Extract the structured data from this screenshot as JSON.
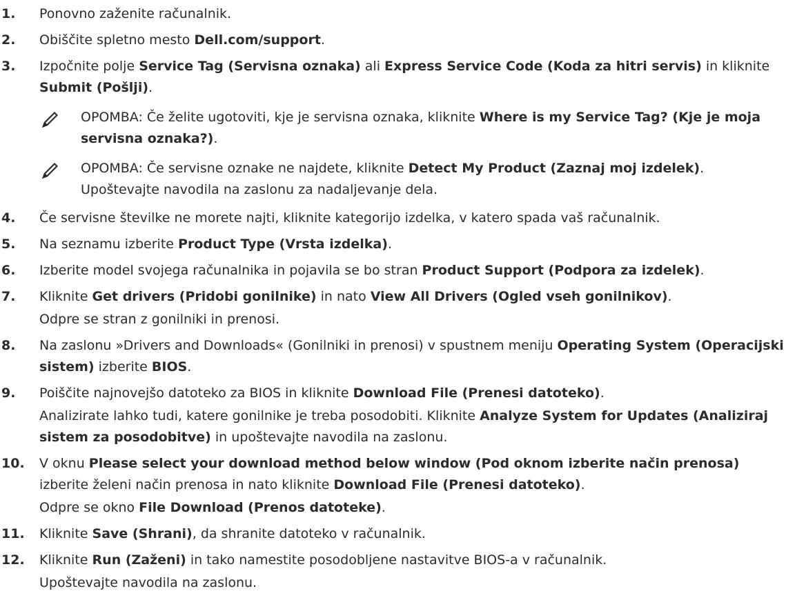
{
  "steps": [
    {
      "num": "1.",
      "parts": [
        {
          "t": "Ponovno zaženite računalnik."
        }
      ]
    },
    {
      "num": "2.",
      "parts": [
        {
          "t": "Obiščite spletno mesto "
        },
        {
          "b": "Dell.com/support"
        },
        {
          "t": "."
        }
      ]
    },
    {
      "num": "3.",
      "parts": [
        {
          "t": "Izpočnite polje "
        },
        {
          "b": "Service Tag (Servisna oznaka)"
        },
        {
          "t": " ali "
        },
        {
          "b": "Express Service Code (Koda za hitri servis)"
        },
        {
          "t": " in kliknite "
        },
        {
          "b": "Submit (Pošlji)"
        },
        {
          "t": "."
        }
      ],
      "notes": [
        {
          "label": "OPOMBA:",
          "parts": [
            {
              "t": " Če želite ugotoviti, kje je servisna oznaka, kliknite "
            },
            {
              "b": "Where is my Service Tag? (Kje je moja servisna oznaka?)"
            },
            {
              "t": "."
            }
          ]
        },
        {
          "label": "OPOMBA:",
          "parts": [
            {
              "t": " Če servisne oznake ne najdete, kliknite "
            },
            {
              "b": "Detect My Product (Zaznaj moj izdelek)"
            },
            {
              "t": ". Upoštevajte navodila na zaslonu za nadaljevanje dela."
            }
          ]
        }
      ]
    },
    {
      "num": "4.",
      "parts": [
        {
          "t": "Če servisne številke ne morete najti, kliknite kategorijo izdelka, v katero spada vaš računalnik."
        }
      ]
    },
    {
      "num": "5.",
      "parts": [
        {
          "t": "Na seznamu izberite "
        },
        {
          "b": "Product Type (Vrsta izdelka)"
        },
        {
          "t": "."
        }
      ]
    },
    {
      "num": "6.",
      "parts": [
        {
          "t": "Izberite model svojega računalnika in pojavila se bo stran "
        },
        {
          "b": "Product Support (Podpora za izdelek)"
        },
        {
          "t": "."
        }
      ]
    },
    {
      "num": "7.",
      "parts": [
        {
          "t": "Kliknite "
        },
        {
          "b": "Get drivers (Pridobi gonilnike)"
        },
        {
          "t": " in nato "
        },
        {
          "b": "View All Drivers (Ogled vseh gonilnikov)"
        },
        {
          "t": "."
        }
      ],
      "subs": [
        [
          {
            "t": "Odpre se stran z gonilniki in prenosi."
          }
        ]
      ]
    },
    {
      "num": "8.",
      "parts": [
        {
          "t": "Na zaslonu »Drivers and Downloads« (Gonilniki in prenosi) v spustnem meniju "
        },
        {
          "b": "Operating System (Operacijski sistem)"
        },
        {
          "t": " izberite "
        },
        {
          "b": "BIOS"
        },
        {
          "t": "."
        }
      ]
    },
    {
      "num": "9.",
      "parts": [
        {
          "t": "Poiščite najnovejšo datoteko za BIOS in kliknite "
        },
        {
          "b": "Download File (Prenesi datoteko)"
        },
        {
          "t": "."
        }
      ],
      "subs": [
        [
          {
            "t": "Analizirate lahko tudi, katere gonilnike je treba posodobiti. Kliknite "
          },
          {
            "b": "Analyze System for Updates (Analiziraj sistem za posodobitve)"
          },
          {
            "t": " in upoštevajte navodila na zaslonu."
          }
        ]
      ]
    },
    {
      "num": "10.",
      "parts": [
        {
          "t": "V oknu "
        },
        {
          "b": "Please select your download method below window (Pod oknom izberite način prenosa)"
        },
        {
          "t": " izberite želeni način prenosa in nato kliknite "
        },
        {
          "b": "Download File (Prenesi datoteko)"
        },
        {
          "t": "."
        }
      ],
      "subs": [
        [
          {
            "t": "Odpre se okno "
          },
          {
            "b": "File Download (Prenos datoteke)"
          },
          {
            "t": "."
          }
        ]
      ]
    },
    {
      "num": "11.",
      "parts": [
        {
          "t": "Kliknite "
        },
        {
          "b": "Save (Shrani)"
        },
        {
          "t": ", da shranite datoteko v računalnik."
        }
      ]
    },
    {
      "num": "12.",
      "parts": [
        {
          "t": "Kliknite "
        },
        {
          "b": "Run (Zaženi)"
        },
        {
          "t": " in tako namestite posodobljene nastavitve BIOS-a v računalnik."
        }
      ],
      "subs": [
        [
          {
            "t": "Upoštevajte navodila na zaslonu."
          }
        ]
      ]
    }
  ]
}
